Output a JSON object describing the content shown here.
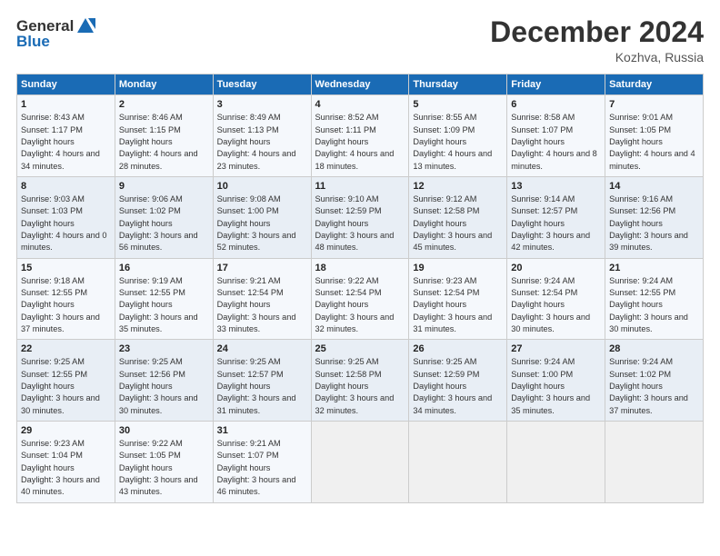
{
  "header": {
    "logo_general": "General",
    "logo_blue": "Blue",
    "month_title": "December 2024",
    "location": "Kozhva, Russia"
  },
  "weekdays": [
    "Sunday",
    "Monday",
    "Tuesday",
    "Wednesday",
    "Thursday",
    "Friday",
    "Saturday"
  ],
  "weeks": [
    [
      {
        "day": "1",
        "sunrise": "8:43 AM",
        "sunset": "1:17 PM",
        "daylight": "4 hours and 34 minutes."
      },
      {
        "day": "2",
        "sunrise": "8:46 AM",
        "sunset": "1:15 PM",
        "daylight": "4 hours and 28 minutes."
      },
      {
        "day": "3",
        "sunrise": "8:49 AM",
        "sunset": "1:13 PM",
        "daylight": "4 hours and 23 minutes."
      },
      {
        "day": "4",
        "sunrise": "8:52 AM",
        "sunset": "1:11 PM",
        "daylight": "4 hours and 18 minutes."
      },
      {
        "day": "5",
        "sunrise": "8:55 AM",
        "sunset": "1:09 PM",
        "daylight": "4 hours and 13 minutes."
      },
      {
        "day": "6",
        "sunrise": "8:58 AM",
        "sunset": "1:07 PM",
        "daylight": "4 hours and 8 minutes."
      },
      {
        "day": "7",
        "sunrise": "9:01 AM",
        "sunset": "1:05 PM",
        "daylight": "4 hours and 4 minutes."
      }
    ],
    [
      {
        "day": "8",
        "sunrise": "9:03 AM",
        "sunset": "1:03 PM",
        "daylight": "4 hours and 0 minutes."
      },
      {
        "day": "9",
        "sunrise": "9:06 AM",
        "sunset": "1:02 PM",
        "daylight": "3 hours and 56 minutes."
      },
      {
        "day": "10",
        "sunrise": "9:08 AM",
        "sunset": "1:00 PM",
        "daylight": "3 hours and 52 minutes."
      },
      {
        "day": "11",
        "sunrise": "9:10 AM",
        "sunset": "12:59 PM",
        "daylight": "3 hours and 48 minutes."
      },
      {
        "day": "12",
        "sunrise": "9:12 AM",
        "sunset": "12:58 PM",
        "daylight": "3 hours and 45 minutes."
      },
      {
        "day": "13",
        "sunrise": "9:14 AM",
        "sunset": "12:57 PM",
        "daylight": "3 hours and 42 minutes."
      },
      {
        "day": "14",
        "sunrise": "9:16 AM",
        "sunset": "12:56 PM",
        "daylight": "3 hours and 39 minutes."
      }
    ],
    [
      {
        "day": "15",
        "sunrise": "9:18 AM",
        "sunset": "12:55 PM",
        "daylight": "3 hours and 37 minutes."
      },
      {
        "day": "16",
        "sunrise": "9:19 AM",
        "sunset": "12:55 PM",
        "daylight": "3 hours and 35 minutes."
      },
      {
        "day": "17",
        "sunrise": "9:21 AM",
        "sunset": "12:54 PM",
        "daylight": "3 hours and 33 minutes."
      },
      {
        "day": "18",
        "sunrise": "9:22 AM",
        "sunset": "12:54 PM",
        "daylight": "3 hours and 32 minutes."
      },
      {
        "day": "19",
        "sunrise": "9:23 AM",
        "sunset": "12:54 PM",
        "daylight": "3 hours and 31 minutes."
      },
      {
        "day": "20",
        "sunrise": "9:24 AM",
        "sunset": "12:54 PM",
        "daylight": "3 hours and 30 minutes."
      },
      {
        "day": "21",
        "sunrise": "9:24 AM",
        "sunset": "12:55 PM",
        "daylight": "3 hours and 30 minutes."
      }
    ],
    [
      {
        "day": "22",
        "sunrise": "9:25 AM",
        "sunset": "12:55 PM",
        "daylight": "3 hours and 30 minutes."
      },
      {
        "day": "23",
        "sunrise": "9:25 AM",
        "sunset": "12:56 PM",
        "daylight": "3 hours and 30 minutes."
      },
      {
        "day": "24",
        "sunrise": "9:25 AM",
        "sunset": "12:57 PM",
        "daylight": "3 hours and 31 minutes."
      },
      {
        "day": "25",
        "sunrise": "9:25 AM",
        "sunset": "12:58 PM",
        "daylight": "3 hours and 32 minutes."
      },
      {
        "day": "26",
        "sunrise": "9:25 AM",
        "sunset": "12:59 PM",
        "daylight": "3 hours and 34 minutes."
      },
      {
        "day": "27",
        "sunrise": "9:24 AM",
        "sunset": "1:00 PM",
        "daylight": "3 hours and 35 minutes."
      },
      {
        "day": "28",
        "sunrise": "9:24 AM",
        "sunset": "1:02 PM",
        "daylight": "3 hours and 37 minutes."
      }
    ],
    [
      {
        "day": "29",
        "sunrise": "9:23 AM",
        "sunset": "1:04 PM",
        "daylight": "3 hours and 40 minutes."
      },
      {
        "day": "30",
        "sunrise": "9:22 AM",
        "sunset": "1:05 PM",
        "daylight": "3 hours and 43 minutes."
      },
      {
        "day": "31",
        "sunrise": "9:21 AM",
        "sunset": "1:07 PM",
        "daylight": "3 hours and 46 minutes."
      },
      null,
      null,
      null,
      null
    ]
  ]
}
